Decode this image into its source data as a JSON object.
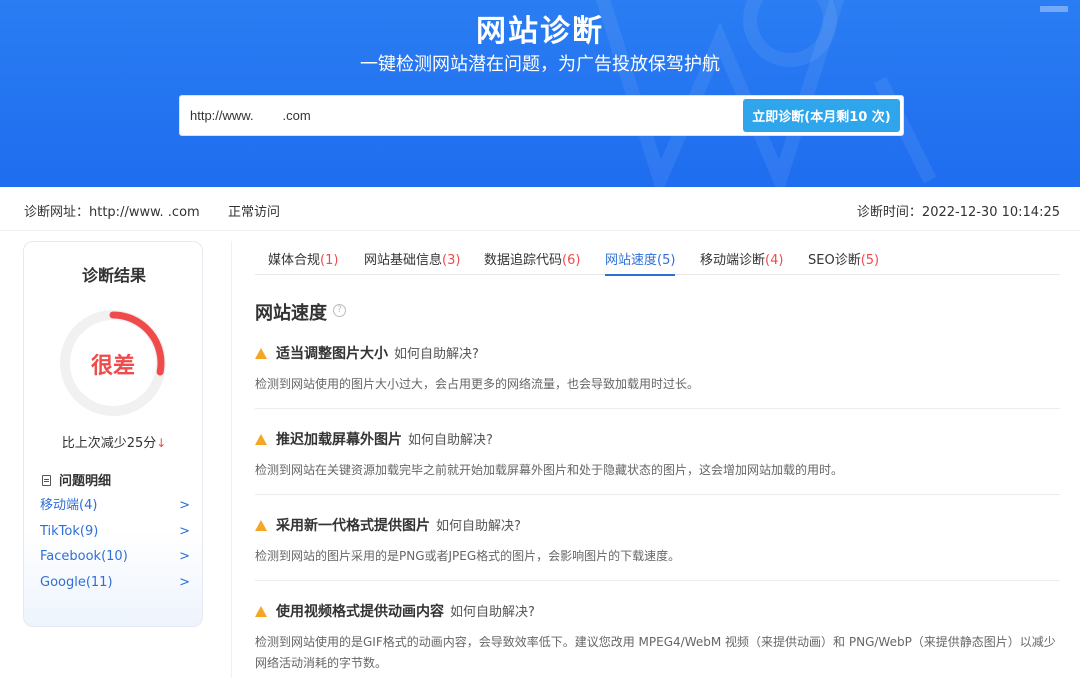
{
  "hero": {
    "title": "网站诊断",
    "subtitle": "一键检测网站潜在问题，为广告投放保驾护航",
    "search_value": "http://www.        .com",
    "button_label": "立即诊断(本月剩10  次)"
  },
  "info": {
    "url": "诊断网址：http://www.          .com",
    "status": "正常访问",
    "time": "诊断时间：2022-12-30 10:14:25"
  },
  "result": {
    "title": "诊断结果",
    "grade": "很差",
    "compare": "比上次减少25分",
    "compare_arrow": "↓",
    "score_fraction": 0.28,
    "issues_title": "问题明细",
    "issues": [
      {
        "label": "移动端(4)"
      },
      {
        "label": "TikTok(9)"
      },
      {
        "label": "Facebook(10)"
      },
      {
        "label": "Google(11)"
      }
    ]
  },
  "tabs": [
    {
      "name": "媒体合规",
      "count": "(1)"
    },
    {
      "name": "网站基础信息",
      "count": "(3)"
    },
    {
      "name": "数据追踪代码",
      "count": "(6)"
    },
    {
      "name": "网站速度",
      "count": "(5)"
    },
    {
      "name": "移动端诊断",
      "count": "(4)"
    },
    {
      "name": "SEO诊断",
      "count": "(5)"
    }
  ],
  "section": {
    "title": "网站速度",
    "help": "?",
    "howto": "如何自助解决?",
    "items": [
      {
        "title": "适当调整图片大小",
        "desc": "检测到网站使用的图片大小过大，会占用更多的网络流量，也会导致加载用时过长。"
      },
      {
        "title": "推迟加载屏幕外图片",
        "desc": "检测到网站在关键资源加载完毕之前就开始加载屏幕外图片和处于隐藏状态的图片，这会增加网站加载的用时。"
      },
      {
        "title": "采用新一代格式提供图片",
        "desc": "检测到网站的图片采用的是PNG或者JPEG格式的图片，会影响图片的下载速度。"
      },
      {
        "title": "使用视频格式提供动画内容",
        "desc": "检测到网站使用的是GIF格式的动画内容，会导致效率低下。建议您改用 MPEG4/WebM 视频（来提供动画）和 PNG/WebP（来提供静态图片）以减少网络活动消耗的字节数。"
      }
    ]
  },
  "colors": {
    "hero": "#1f6df0",
    "accent": "#2f6fd6",
    "danger": "#ef4b4b",
    "warn": "#f5a623",
    "button": "#2fa6ec"
  }
}
